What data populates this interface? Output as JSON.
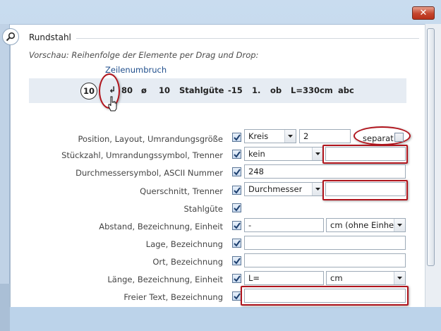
{
  "window": {
    "close_symbol": "✕"
  },
  "section": {
    "title": "Rundstahl",
    "hint": "Vorschau: Reihenfolge der Elemente per Drag und Drop:",
    "zeilenumbruch": "Zeilenumbruch"
  },
  "preview": {
    "tokens": [
      "10",
      "↲",
      "80",
      "ø",
      "10",
      "Stahlgüte",
      "-15",
      "1.",
      "ob",
      "L=330cm",
      "abc"
    ]
  },
  "rows": [
    {
      "label": "Position, Layout, Umrandungsgröße",
      "checked": true,
      "combo": "Kreis",
      "text": "2",
      "separat_label": "separat",
      "separat_checked": false
    },
    {
      "label": "Stückzahl, Umrandungssymbol, Trenner",
      "checked": true,
      "combo": "kein",
      "text": ""
    },
    {
      "label": "Durchmessersymbol, ASCII Nummer",
      "checked": true,
      "text": "248"
    },
    {
      "label": "Querschnitt, Trenner",
      "checked": true,
      "combo": "Durchmesser",
      "text": ""
    },
    {
      "label": "Stahlgüte",
      "checked": true
    },
    {
      "label": "Abstand, Bezeichnung, Einheit",
      "checked": true,
      "text": "-",
      "combo": "cm (ohne Einheit)"
    },
    {
      "label": "Lage, Bezeichnung",
      "checked": true,
      "text": ""
    },
    {
      "label": "Ort, Bezeichnung",
      "checked": true,
      "text": ""
    },
    {
      "label": "Länge, Bezeichnung, Einheit",
      "checked": true,
      "text": "L=",
      "combo": "cm"
    },
    {
      "label": "Freier Text, Bezeichnung",
      "checked": true,
      "text": ""
    }
  ],
  "colors": {
    "highlight": "#b0141c",
    "accent": "#1f4e8c"
  },
  "icons": [
    "search-icon",
    "close-icon",
    "line-break-icon",
    "hand-cursor-icon",
    "dropdown-arrow-icon",
    "checkmark-icon"
  ]
}
